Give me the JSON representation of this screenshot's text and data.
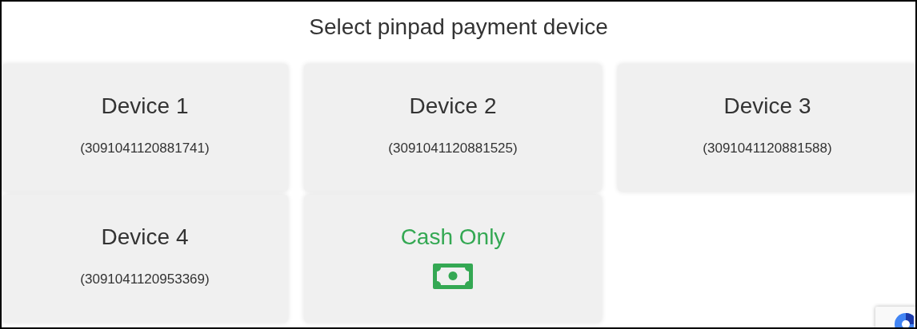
{
  "title": "Select pinpad payment device",
  "options": [
    {
      "kind": "device",
      "name": "Device 1",
      "serial": "(3091041120881741)"
    },
    {
      "kind": "device",
      "name": "Device 2",
      "serial": "(3091041120881525)"
    },
    {
      "kind": "device",
      "name": "Device 3",
      "serial": "(3091041120881588)"
    },
    {
      "kind": "device",
      "name": "Device 4",
      "serial": "(3091041120953369)"
    },
    {
      "kind": "cash",
      "name": "Cash Only"
    }
  ]
}
